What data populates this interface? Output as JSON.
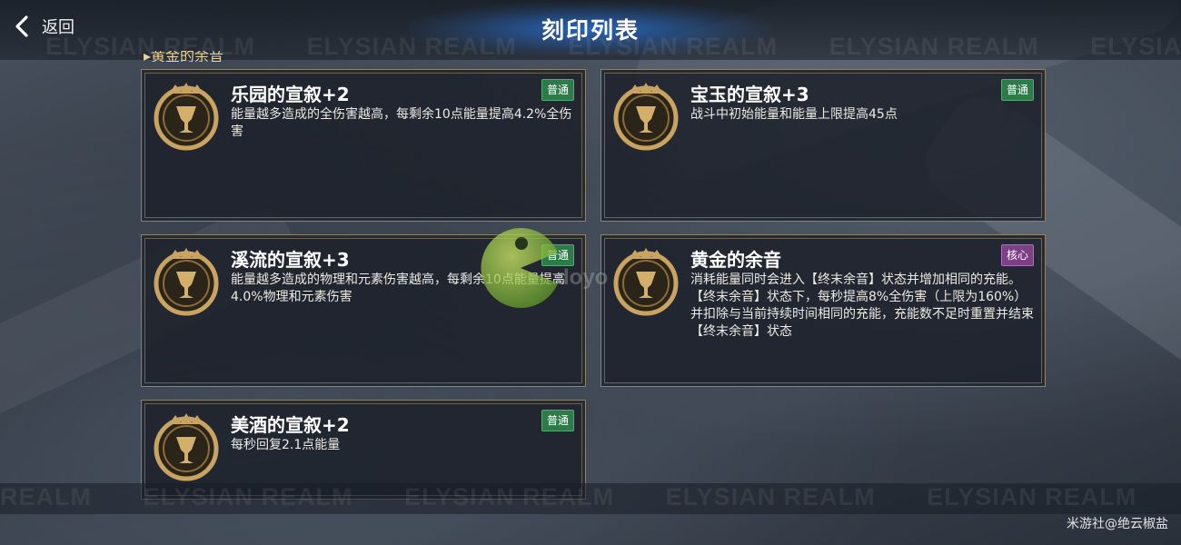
{
  "header": {
    "back_label": "返回",
    "title": "刻印列表"
  },
  "banner": {
    "text": "ELYSIAN REALM",
    "partial_text": "REALM"
  },
  "section": {
    "heading_fragment": "▸黄金的余音"
  },
  "cards": [
    {
      "title": "乐园的宣叙+2",
      "badge": "普通",
      "badge_type": "normal",
      "description": "能量越多造成的全伤害越高，每剩余10点能量提高4.2%全伤害"
    },
    {
      "title": "宝玉的宣叙+3",
      "badge": "普通",
      "badge_type": "normal",
      "description": "战斗中初始能量和能量上限提高45点"
    },
    {
      "title": "溪流的宣叙+3",
      "badge": "普通",
      "badge_type": "normal",
      "description": "能量越多造成的物理和元素伤害越高，每剩余10点能量提高4.0%物理和元素伤害"
    },
    {
      "title": "黄金的余音",
      "badge": "核心",
      "badge_type": "core",
      "description": "消耗能量同时会进入【终末余音】状态并增加相同的充能。【终末余音】状态下，每秒提高8%全伤害（上限为160%）并扣除与当前持续时间相同的充能，充能数不足时重置并结束【终末余音】状态"
    },
    {
      "title": "美酒的宣叙+2",
      "badge": "普通",
      "badge_type": "normal",
      "description": "每秒回复2.1点能量"
    }
  ],
  "watermark": {
    "text": "doyo"
  },
  "credit": "米游社@绝云椒盐",
  "colors": {
    "badge_normal": "#2e7a4a",
    "badge_core": "#7d3f86",
    "title_glow": "#2878e6",
    "emblem_gold": "#c9a362"
  }
}
